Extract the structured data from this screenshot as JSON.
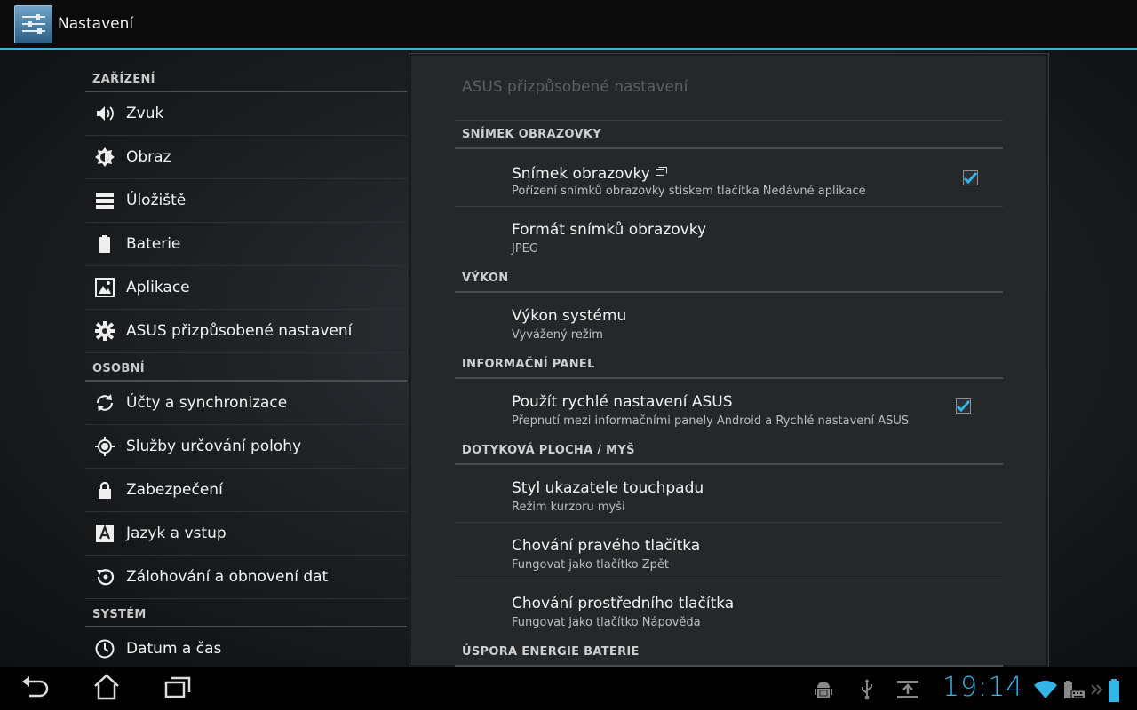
{
  "app": {
    "title": "Nastavení"
  },
  "left": {
    "categories": [
      {
        "title": "ZAŘÍZENÍ",
        "items": [
          {
            "label": "Zvuk",
            "icon": "volume-icon"
          },
          {
            "label": "Obraz",
            "icon": "brightness-icon"
          },
          {
            "label": "Úložiště",
            "icon": "storage-icon"
          },
          {
            "label": "Baterie",
            "icon": "battery-icon"
          },
          {
            "label": "Aplikace",
            "icon": "apps-icon"
          },
          {
            "label": "ASUS přizpůsobené nastavení",
            "icon": "gear-icon"
          }
        ]
      },
      {
        "title": "OSOBNÍ",
        "items": [
          {
            "label": "Účty a synchronizace",
            "icon": "sync-icon"
          },
          {
            "label": "Služby určování polohy",
            "icon": "location-icon"
          },
          {
            "label": "Zabezpečení",
            "icon": "lock-icon"
          },
          {
            "label": "Jazyk a vstup",
            "icon": "language-icon"
          },
          {
            "label": "Zálohování a obnovení dat",
            "icon": "backup-icon"
          }
        ]
      },
      {
        "title": "SYSTÉM",
        "items": [
          {
            "label": "Datum a čas",
            "icon": "clock-icon"
          }
        ]
      }
    ]
  },
  "right": {
    "title": "ASUS přizpůsobené nastavení",
    "sections": [
      {
        "title": "SNÍMEK OBRAZOVKY",
        "prefs": [
          {
            "title": "Snímek obrazovky",
            "summary": "Pořízení snímků obrazovky stiskem tlačítka Nedávné aplikace",
            "checked": true
          },
          {
            "title": "Formát snímků obrazovky",
            "summary": "JPEG"
          }
        ]
      },
      {
        "title": "VÝKON",
        "prefs": [
          {
            "title": "Výkon systému",
            "summary": "Vyvážený režim"
          }
        ]
      },
      {
        "title": "INFORMAČNÍ PANEL",
        "prefs": [
          {
            "title": "Použít rychlé nastavení ASUS",
            "summary": "Přepnutí mezi informačními panely Android a Rychlé nastavení ASUS",
            "checked": true
          }
        ]
      },
      {
        "title": "DOTYKOVÁ PLOCHA / MYŠ",
        "prefs": [
          {
            "title": "Styl ukazatele touchpadu",
            "summary": "Režim kurzoru myši"
          },
          {
            "title": "Chování pravého tlačítka",
            "summary": "Fungovat jako tlačítko Zpět"
          },
          {
            "title": "Chování prostředního tlačítka",
            "summary": "Fungovat jako tlačítko Nápověda"
          }
        ]
      },
      {
        "title": "ÚSPORA ENERGIE BATERIE",
        "prefs": []
      }
    ]
  },
  "status": {
    "time": "19:14"
  },
  "colors": {
    "accent": "#33b5e5",
    "background": "#1b1d20",
    "pane": "#252729"
  }
}
